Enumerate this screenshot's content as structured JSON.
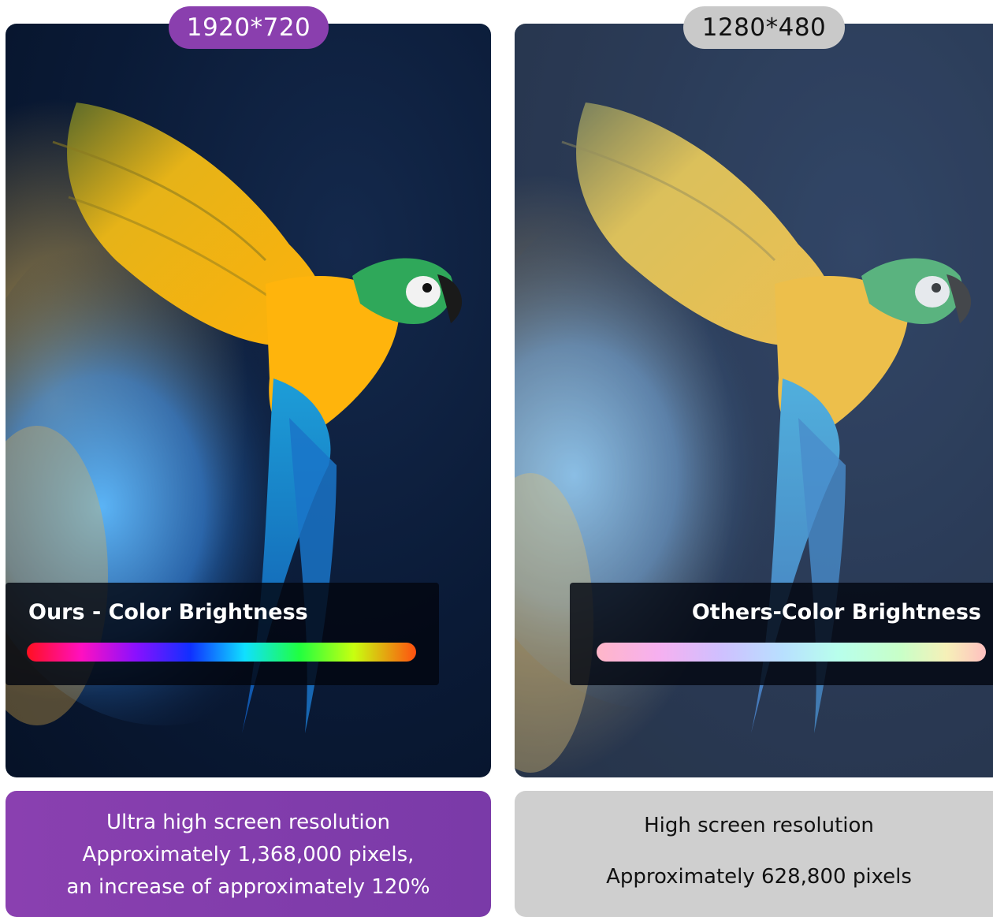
{
  "left": {
    "resolution_label": "1920*720",
    "overlay_title": "Ours - Color Brightness",
    "info_lines": [
      "Ultra high screen resolution",
      "Approximately 1,368,000 pixels,",
      "an increase of approximately 120%"
    ],
    "accent_color": "#8a3fae"
  },
  "right": {
    "resolution_label": "1280*480",
    "overlay_title": "Others-Color Brightness",
    "info_lines": [
      "High screen resolution",
      "Approximately 628,800 pixels"
    ],
    "accent_color": "#c9c9c9"
  },
  "image_subject": "parrot-icon"
}
